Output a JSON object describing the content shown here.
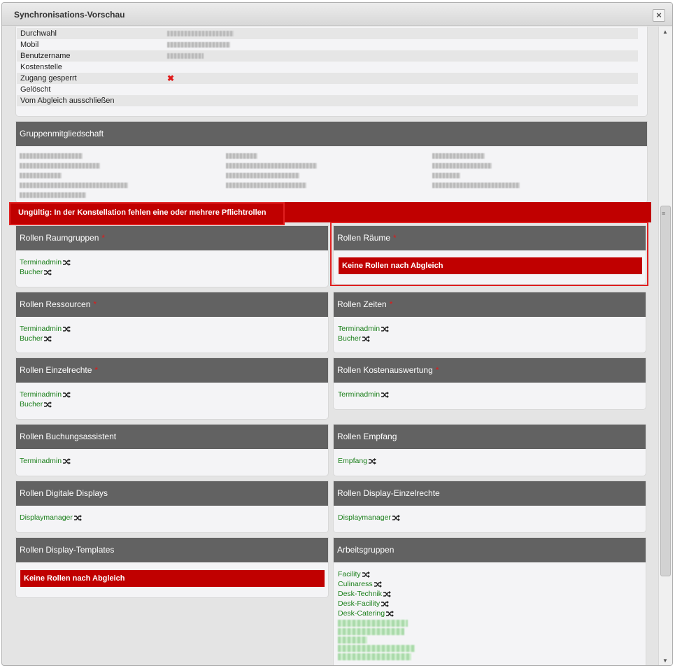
{
  "dialog": {
    "title": "Synchronisations-Vorschau",
    "close_label": "×"
  },
  "user_info": {
    "rows": [
      {
        "label": "Durchwahl"
      },
      {
        "label": "Mobil"
      },
      {
        "label": "Benutzername"
      },
      {
        "label": "Kostenstelle"
      },
      {
        "label": "Zugang gesperrt",
        "flag": "✖"
      },
      {
        "label": "Gelöscht"
      },
      {
        "label": "Vom Abgleich ausschließen"
      }
    ]
  },
  "groups": {
    "title": "Gruppenmitgliedschaft"
  },
  "validation": {
    "message": "Ungültig: In der Konstellation fehlen eine oder mehrere Pflichtrollen"
  },
  "required_marker": "*",
  "no_roles_message": "Keine Rollen nach Abgleich",
  "panels": {
    "raumgruppen": {
      "title": "Rollen Raumgruppen",
      "roles": [
        "Terminadmin",
        "Bucher"
      ]
    },
    "raeume": {
      "title": "Rollen Räume",
      "message": "Keine Rollen nach Abgleich"
    },
    "ressourcen": {
      "title": "Rollen Ressourcen",
      "roles": [
        "Terminadmin",
        "Bucher"
      ]
    },
    "zeiten": {
      "title": "Rollen Zeiten",
      "roles": [
        "Terminadmin",
        "Bucher"
      ]
    },
    "einzelrechte": {
      "title": "Rollen Einzelrechte",
      "roles": [
        "Terminadmin",
        "Bucher"
      ]
    },
    "kostenauswertung": {
      "title": "Rollen Kostenauswertung",
      "roles": [
        "Terminadmin"
      ]
    },
    "buchungsassistent": {
      "title": "Rollen Buchungsassistent",
      "roles": [
        "Terminadmin"
      ]
    },
    "empfang": {
      "title": "Rollen Empfang",
      "roles": [
        "Empfang"
      ]
    },
    "digitale_displays": {
      "title": "Rollen Digitale Displays",
      "roles": [
        "Displaymanager"
      ]
    },
    "display_einzelrechte": {
      "title": "Rollen Display-Einzelrechte",
      "roles": [
        "Displaymanager"
      ]
    },
    "display_templates": {
      "title": "Rollen Display-Templates",
      "message": "Keine Rollen nach Abgleich"
    },
    "arbeitsgruppen": {
      "title": "Arbeitsgruppen",
      "roles": [
        "Facility",
        "Culinaress",
        "Desk-Technik",
        "Desk-Facility",
        "Desk-Catering"
      ]
    }
  },
  "icons": {
    "close": "close-icon",
    "shuffle": "shuffle-icon",
    "scroll_up": "arrow-up-icon",
    "scroll_down": "arrow-down-icon"
  },
  "colors": {
    "header": "#626262",
    "error": "#c00000",
    "role_link": "#1a7f1a",
    "required": "#e01a1a"
  }
}
